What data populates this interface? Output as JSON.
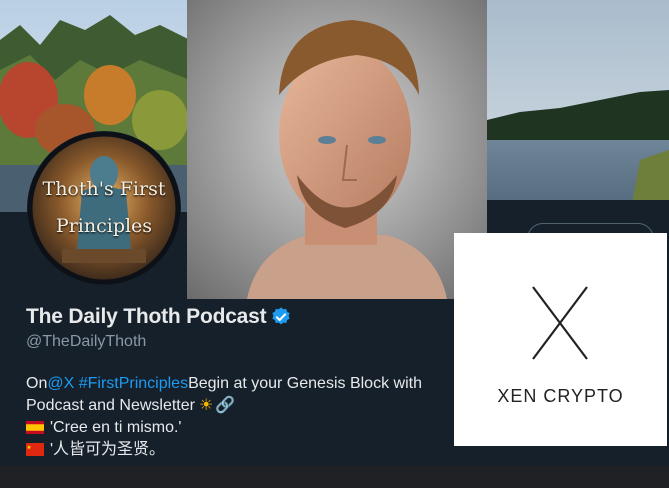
{
  "avatar": {
    "line1": "Thoth's First",
    "line2": "Principles"
  },
  "profile": {
    "display_name": "The Daily Thoth Podcast",
    "handle": "@TheDailyThoth",
    "verified_icon": "verified-badge-icon"
  },
  "bio": {
    "line1_prefix": "On ",
    "line1_mention": "@X",
    "line1_hashtag": "#FirstPrinciples",
    "line1_rest": " Begin at your Genesis Block with",
    "line2": "Podcast and Newsletter",
    "line3": "'Cree en ti mismo.'",
    "line4": "'人皆可为圣贤。"
  },
  "ad_card": {
    "label": "XEN CRYPTO"
  },
  "colors": {
    "link": "#1d9bf0",
    "background": "#15202b",
    "verified": "#1d9bf0"
  }
}
